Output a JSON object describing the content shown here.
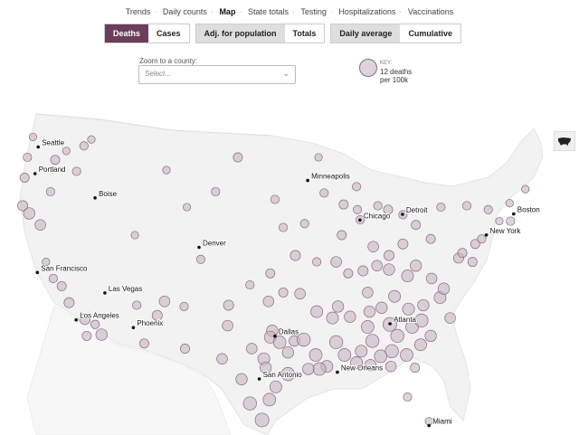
{
  "nav": {
    "items": [
      {
        "label": "Trends",
        "active": false
      },
      {
        "label": "Daily counts",
        "active": false
      },
      {
        "label": "Map",
        "active": true
      },
      {
        "label": "State totals",
        "active": false
      },
      {
        "label": "Testing",
        "active": false
      },
      {
        "label": "Hospitalizations",
        "active": false
      },
      {
        "label": "Vaccinations",
        "active": false
      }
    ]
  },
  "toggles": {
    "metric": {
      "deaths": "Deaths",
      "cases": "Cases",
      "selected": "Deaths"
    },
    "scale": {
      "adjusted": "Adj. for population",
      "totals": "Totals",
      "selected": "Adj. for population"
    },
    "period": {
      "daily": "Daily average",
      "cumulative": "Cumulative",
      "selected": "Daily average"
    }
  },
  "zoom": {
    "label": "Zoom to a county:",
    "placeholder": "Select..."
  },
  "key": {
    "head": "KEY:",
    "line1": "12 deaths",
    "line2": "per 100k"
  },
  "colors": {
    "accent": "#6b3e5b",
    "bubble_fill": "#c8b4c4",
    "bubble_stroke": "#8a6a80",
    "land": "#f2f2f2"
  },
  "cities": [
    {
      "name": "Seattle",
      "lon": -122.33,
      "lat": 47.61
    },
    {
      "name": "Portland",
      "lon": -122.68,
      "lat": 45.52
    },
    {
      "name": "Boise",
      "lon": -116.2,
      "lat": 43.62
    },
    {
      "name": "San Francisco",
      "lon": -122.42,
      "lat": 37.77
    },
    {
      "name": "Las Vegas",
      "lon": -115.14,
      "lat": 36.17
    },
    {
      "name": "Los Angeles",
      "lon": -118.24,
      "lat": 34.05
    },
    {
      "name": "Phoenix",
      "lon": -112.07,
      "lat": 33.45
    },
    {
      "name": "Denver",
      "lon": -104.99,
      "lat": 39.74
    },
    {
      "name": "Minneapolis",
      "lon": -93.27,
      "lat": 44.98
    },
    {
      "name": "Chicago",
      "lon": -87.63,
      "lat": 41.88
    },
    {
      "name": "Detroit",
      "lon": -83.05,
      "lat": 42.33
    },
    {
      "name": "Boston",
      "lon": -71.06,
      "lat": 42.36
    },
    {
      "name": "New York",
      "lon": -74.0,
      "lat": 40.71
    },
    {
      "name": "Dallas",
      "lon": -96.8,
      "lat": 32.78
    },
    {
      "name": "San Antonio",
      "lon": -98.49,
      "lat": 29.42
    },
    {
      "name": "Atlanta",
      "lon": -84.39,
      "lat": 33.75
    },
    {
      "name": "New Orleans",
      "lon": -90.07,
      "lat": 29.95
    },
    {
      "name": "Miami",
      "lon": -80.19,
      "lat": 25.76
    }
  ],
  "bubbles": [
    {
      "lon": -123.5,
      "lat": 46.8,
      "v": 5
    },
    {
      "lon": -122.9,
      "lat": 48.4,
      "v": 4
    },
    {
      "lon": -123.8,
      "lat": 45.2,
      "v": 6
    },
    {
      "lon": -124.0,
      "lat": 43.0,
      "v": 7
    },
    {
      "lon": -123.3,
      "lat": 42.4,
      "v": 9
    },
    {
      "lon": -122.1,
      "lat": 41.5,
      "v": 8
    },
    {
      "lon": -121.0,
      "lat": 44.1,
      "v": 5
    },
    {
      "lon": -120.5,
      "lat": 46.6,
      "v": 6
    },
    {
      "lon": -119.3,
      "lat": 47.3,
      "v": 4
    },
    {
      "lon": -117.4,
      "lat": 47.7,
      "v": 5
    },
    {
      "lon": -116.6,
      "lat": 48.2,
      "v": 4
    },
    {
      "lon": -118.2,
      "lat": 45.7,
      "v": 5
    },
    {
      "lon": -121.5,
      "lat": 38.6,
      "v": 4
    },
    {
      "lon": -120.7,
      "lat": 37.3,
      "v": 5
    },
    {
      "lon": -119.8,
      "lat": 36.7,
      "v": 6
    },
    {
      "lon": -119.0,
      "lat": 35.4,
      "v": 7
    },
    {
      "lon": -117.3,
      "lat": 34.1,
      "v": 8
    },
    {
      "lon": -117.1,
      "lat": 32.8,
      "v": 6
    },
    {
      "lon": -116.2,
      "lat": 33.7,
      "v": 5
    },
    {
      "lon": -115.5,
      "lat": 32.9,
      "v": 9
    },
    {
      "lon": -111.9,
      "lat": 40.7,
      "v": 4
    },
    {
      "lon": -111.7,
      "lat": 35.2,
      "v": 5
    },
    {
      "lon": -110.9,
      "lat": 32.2,
      "v": 6
    },
    {
      "lon": -109.5,
      "lat": 34.4,
      "v": 7
    },
    {
      "lon": -108.7,
      "lat": 35.5,
      "v": 8
    },
    {
      "lon": -106.6,
      "lat": 35.1,
      "v": 5
    },
    {
      "lon": -106.5,
      "lat": 31.8,
      "v": 6
    },
    {
      "lon": -104.8,
      "lat": 38.8,
      "v": 5
    },
    {
      "lon": -108.5,
      "lat": 45.8,
      "v": 4
    },
    {
      "lon": -106.3,
      "lat": 42.9,
      "v": 4
    },
    {
      "lon": -103.2,
      "lat": 44.1,
      "v": 5
    },
    {
      "lon": -100.8,
      "lat": 46.8,
      "v": 6
    },
    {
      "lon": -96.8,
      "lat": 43.5,
      "v": 5
    },
    {
      "lon": -97.3,
      "lat": 37.7,
      "v": 6
    },
    {
      "lon": -95.9,
      "lat": 41.3,
      "v": 5
    },
    {
      "lon": -94.6,
      "lat": 39.1,
      "v": 7
    },
    {
      "lon": -93.6,
      "lat": 41.6,
      "v": 5
    },
    {
      "lon": -90.2,
      "lat": 38.6,
      "v": 8
    },
    {
      "lon": -92.3,
      "lat": 38.6,
      "v": 5
    },
    {
      "lon": -97.5,
      "lat": 35.5,
      "v": 8
    },
    {
      "lon": -95.9,
      "lat": 36.2,
      "v": 6
    },
    {
      "lon": -99.5,
      "lat": 36.8,
      "v": 5
    },
    {
      "lon": -101.8,
      "lat": 35.2,
      "v": 7
    },
    {
      "lon": -101.9,
      "lat": 33.6,
      "v": 8
    },
    {
      "lon": -97.1,
      "lat": 33.2,
      "v": 9
    },
    {
      "lon": -97.3,
      "lat": 32.7,
      "v": 10
    },
    {
      "lon": -96.3,
      "lat": 32.3,
      "v": 11
    },
    {
      "lon": -95.4,
      "lat": 31.5,
      "v": 9
    },
    {
      "lon": -94.7,
      "lat": 32.4,
      "v": 8
    },
    {
      "lon": -95.4,
      "lat": 29.8,
      "v": 12
    },
    {
      "lon": -96.7,
      "lat": 28.8,
      "v": 10
    },
    {
      "lon": -97.4,
      "lat": 27.8,
      "v": 11
    },
    {
      "lon": -98.2,
      "lat": 26.2,
      "v": 13
    },
    {
      "lon": -99.5,
      "lat": 27.5,
      "v": 12
    },
    {
      "lon": -100.4,
      "lat": 29.4,
      "v": 9
    },
    {
      "lon": -102.5,
      "lat": 31.0,
      "v": 8
    },
    {
      "lon": -98.0,
      "lat": 31.0,
      "v": 10
    },
    {
      "lon": -97.8,
      "lat": 30.3,
      "v": 9
    },
    {
      "lon": -99.3,
      "lat": 31.8,
      "v": 8
    },
    {
      "lon": -93.7,
      "lat": 32.5,
      "v": 12
    },
    {
      "lon": -92.4,
      "lat": 31.3,
      "v": 11
    },
    {
      "lon": -91.2,
      "lat": 30.4,
      "v": 10
    },
    {
      "lon": -92.0,
      "lat": 30.2,
      "v": 11
    },
    {
      "lon": -93.2,
      "lat": 30.2,
      "v": 9
    },
    {
      "lon": -90.2,
      "lat": 32.3,
      "v": 12
    },
    {
      "lon": -89.3,
      "lat": 31.3,
      "v": 11
    },
    {
      "lon": -88.7,
      "lat": 34.3,
      "v": 9
    },
    {
      "lon": -90.6,
      "lat": 34.2,
      "v": 10
    },
    {
      "lon": -92.3,
      "lat": 34.7,
      "v": 10
    },
    {
      "lon": -94.1,
      "lat": 36.1,
      "v": 8
    },
    {
      "lon": -90.0,
      "lat": 35.1,
      "v": 9
    },
    {
      "lon": -88.0,
      "lat": 30.7,
      "v": 10
    },
    {
      "lon": -86.8,
      "lat": 33.5,
      "v": 11
    },
    {
      "lon": -86.3,
      "lat": 32.4,
      "v": 12
    },
    {
      "lon": -87.5,
      "lat": 31.6,
      "v": 10
    },
    {
      "lon": -85.4,
      "lat": 31.2,
      "v": 11
    },
    {
      "lon": -86.6,
      "lat": 34.7,
      "v": 9
    },
    {
      "lon": -86.8,
      "lat": 36.2,
      "v": 8
    },
    {
      "lon": -85.3,
      "lat": 35.0,
      "v": 9
    },
    {
      "lon": -83.9,
      "lat": 35.9,
      "v": 10
    },
    {
      "lon": -84.4,
      "lat": 33.7,
      "v": 13
    },
    {
      "lon": -83.6,
      "lat": 32.8,
      "v": 12
    },
    {
      "lon": -82.6,
      "lat": 31.3,
      "v": 11
    },
    {
      "lon": -81.1,
      "lat": 32.1,
      "v": 10
    },
    {
      "lon": -84.2,
      "lat": 31.6,
      "v": 12
    },
    {
      "lon": -82.0,
      "lat": 33.5,
      "v": 11
    },
    {
      "lon": -81.0,
      "lat": 34.0,
      "v": 12
    },
    {
      "lon": -80.0,
      "lat": 32.8,
      "v": 9
    },
    {
      "lon": -82.4,
      "lat": 34.9,
      "v": 10
    },
    {
      "lon": -80.8,
      "lat": 35.2,
      "v": 9
    },
    {
      "lon": -79.0,
      "lat": 35.8,
      "v": 10
    },
    {
      "lon": -77.9,
      "lat": 34.2,
      "v": 8
    },
    {
      "lon": -78.6,
      "lat": 36.5,
      "v": 9
    },
    {
      "lon": -79.9,
      "lat": 37.3,
      "v": 8
    },
    {
      "lon": -81.6,
      "lat": 38.3,
      "v": 9
    },
    {
      "lon": -82.5,
      "lat": 37.5,
      "v": 10
    },
    {
      "lon": -84.5,
      "lat": 38.0,
      "v": 9
    },
    {
      "lon": -85.8,
      "lat": 38.3,
      "v": 8
    },
    {
      "lon": -86.2,
      "lat": 39.8,
      "v": 8
    },
    {
      "lon": -83.0,
      "lat": 40.0,
      "v": 7
    },
    {
      "lon": -84.5,
      "lat": 39.1,
      "v": 7
    },
    {
      "lon": -80.0,
      "lat": 40.4,
      "v": 6
    },
    {
      "lon": -81.6,
      "lat": 41.5,
      "v": 6
    },
    {
      "lon": -77.0,
      "lat": 38.9,
      "v": 7
    },
    {
      "lon": -76.6,
      "lat": 39.3,
      "v": 6
    },
    {
      "lon": -75.2,
      "lat": 40.0,
      "v": 6
    },
    {
      "lon": -74.5,
      "lat": 40.4,
      "v": 5
    },
    {
      "lon": -73.8,
      "lat": 42.7,
      "v": 5
    },
    {
      "lon": -72.6,
      "lat": 41.8,
      "v": 4
    },
    {
      "lon": -71.4,
      "lat": 41.8,
      "v": 5
    },
    {
      "lon": -71.5,
      "lat": 43.2,
      "v": 4
    },
    {
      "lon": -69.8,
      "lat": 44.3,
      "v": 4
    },
    {
      "lon": -76.1,
      "lat": 43.0,
      "v": 5
    },
    {
      "lon": -78.9,
      "lat": 42.9,
      "v": 5
    },
    {
      "lon": -83.0,
      "lat": 42.3,
      "v": 5
    },
    {
      "lon": -84.6,
      "lat": 42.7,
      "v": 6
    },
    {
      "lon": -85.7,
      "lat": 43.0,
      "v": 5
    },
    {
      "lon": -87.6,
      "lat": 41.9,
      "v": 5
    },
    {
      "lon": -89.4,
      "lat": 43.1,
      "v": 6
    },
    {
      "lon": -88.0,
      "lat": 44.5,
      "v": 5
    },
    {
      "lon": -91.5,
      "lat": 44.0,
      "v": 5
    },
    {
      "lon": -92.1,
      "lat": 46.8,
      "v": 4
    },
    {
      "lon": -89.6,
      "lat": 40.7,
      "v": 6
    },
    {
      "lon": -87.3,
      "lat": 37.9,
      "v": 7
    },
    {
      "lon": -88.9,
      "lat": 37.7,
      "v": 6
    },
    {
      "lon": -80.2,
      "lat": 26.1,
      "v": 4
    },
    {
      "lon": -81.7,
      "lat": 30.3,
      "v": 6
    },
    {
      "lon": -82.5,
      "lat": 28.0,
      "v": 5
    },
    {
      "lon": -84.3,
      "lat": 30.4,
      "v": 8
    },
    {
      "lon": -86.5,
      "lat": 30.5,
      "v": 9
    },
    {
      "lon": -87.9,
      "lat": 42.7,
      "v": 5
    },
    {
      "lon": -75.5,
      "lat": 38.6,
      "v": 6
    }
  ]
}
